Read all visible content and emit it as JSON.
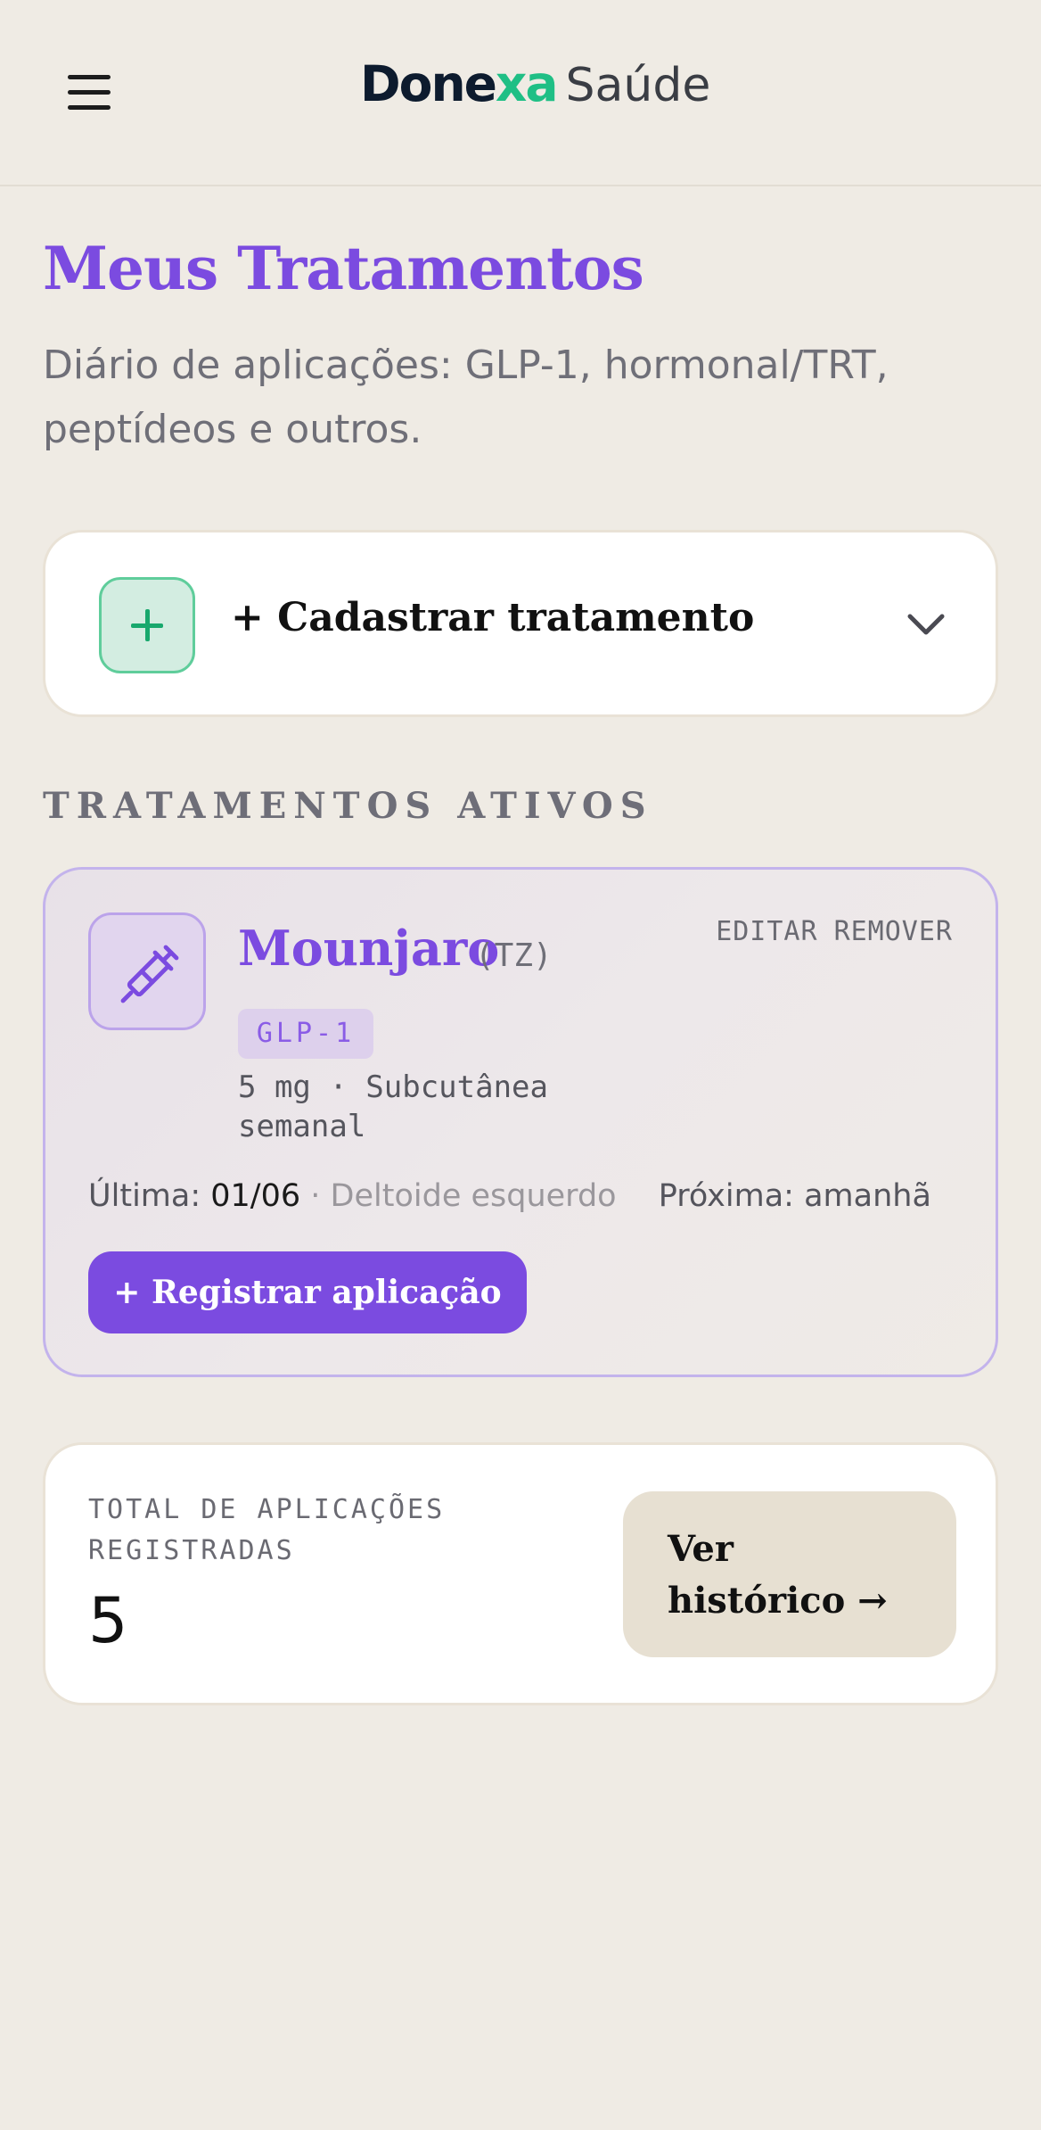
{
  "header": {
    "menu_icon": "hamburger-menu-icon",
    "logo_brand_start": "Done",
    "logo_brand_x": "xa",
    "logo_sub": "Saúde",
    "brand_color": "#0d1b2e",
    "accent_green": "#1fbf85"
  },
  "page": {
    "title": "Meus Tratamentos",
    "subtitle": "Diário de aplicações: GLP-1, hormonal/TRT, peptídeos e outros.",
    "accent_color": "#7b4be0"
  },
  "add_treatment": {
    "icon": "plus-icon",
    "label": "+ Cadastrar tratamento",
    "chevron_icon": "chevron-down-icon"
  },
  "active_section": {
    "label": "TRATAMENTOS ATIVOS"
  },
  "treatments": [
    {
      "icon": "syringe-icon",
      "name": "Mounjaro",
      "abbr": "(TZ)",
      "edit_label": "EDITAR",
      "remove_label": "REMOVER",
      "tag": "GLP-1",
      "dose_line": "5 mg · Subcutânea semanal",
      "last_label": "Última:",
      "last_value": "01/06",
      "last_site": "· Deltoide esquerdo",
      "next_label": "Próxima:",
      "next_value": "amanhã",
      "register_label": "+ Registrar aplicação"
    }
  ],
  "summary": {
    "total_label": "TOTAL DE APLICAÇÕES REGISTRADAS",
    "total_value": "5",
    "history_label": "Ver histórico →"
  }
}
